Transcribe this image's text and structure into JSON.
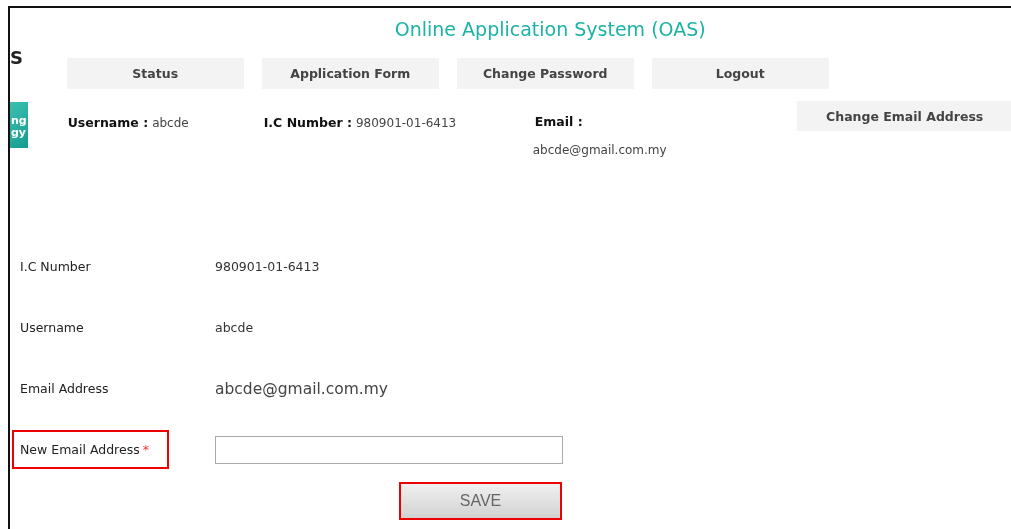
{
  "title": "Online Application System (OAS)",
  "logo_fragments": [
    "S",
    "ng",
    "gy"
  ],
  "nav": [
    {
      "label": "Status"
    },
    {
      "label": "Application Form"
    },
    {
      "label": "Change Password"
    },
    {
      "label": "Logout"
    }
  ],
  "user_info": {
    "username_label": "Username :",
    "username": "abcde",
    "ic_label": "I.C Number :",
    "ic": "980901-01-6413",
    "email_label": "Email :",
    "email": "abcde@gmail.com.my"
  },
  "change_email_button": "Change Email Address",
  "form": [
    {
      "kind": "text",
      "label": "I.C Number",
      "value": "980901-01-6413"
    },
    {
      "kind": "text",
      "label": "Username",
      "value": "abcde"
    },
    {
      "kind": "large",
      "label": "Email Address",
      "value": "abcde@gmail.com.my"
    },
    {
      "kind": "input",
      "label": "New Email Address",
      "required_mark": "*",
      "highlighted": true
    }
  ],
  "save_button": {
    "label": "SAVE",
    "highlighted": true
  }
}
